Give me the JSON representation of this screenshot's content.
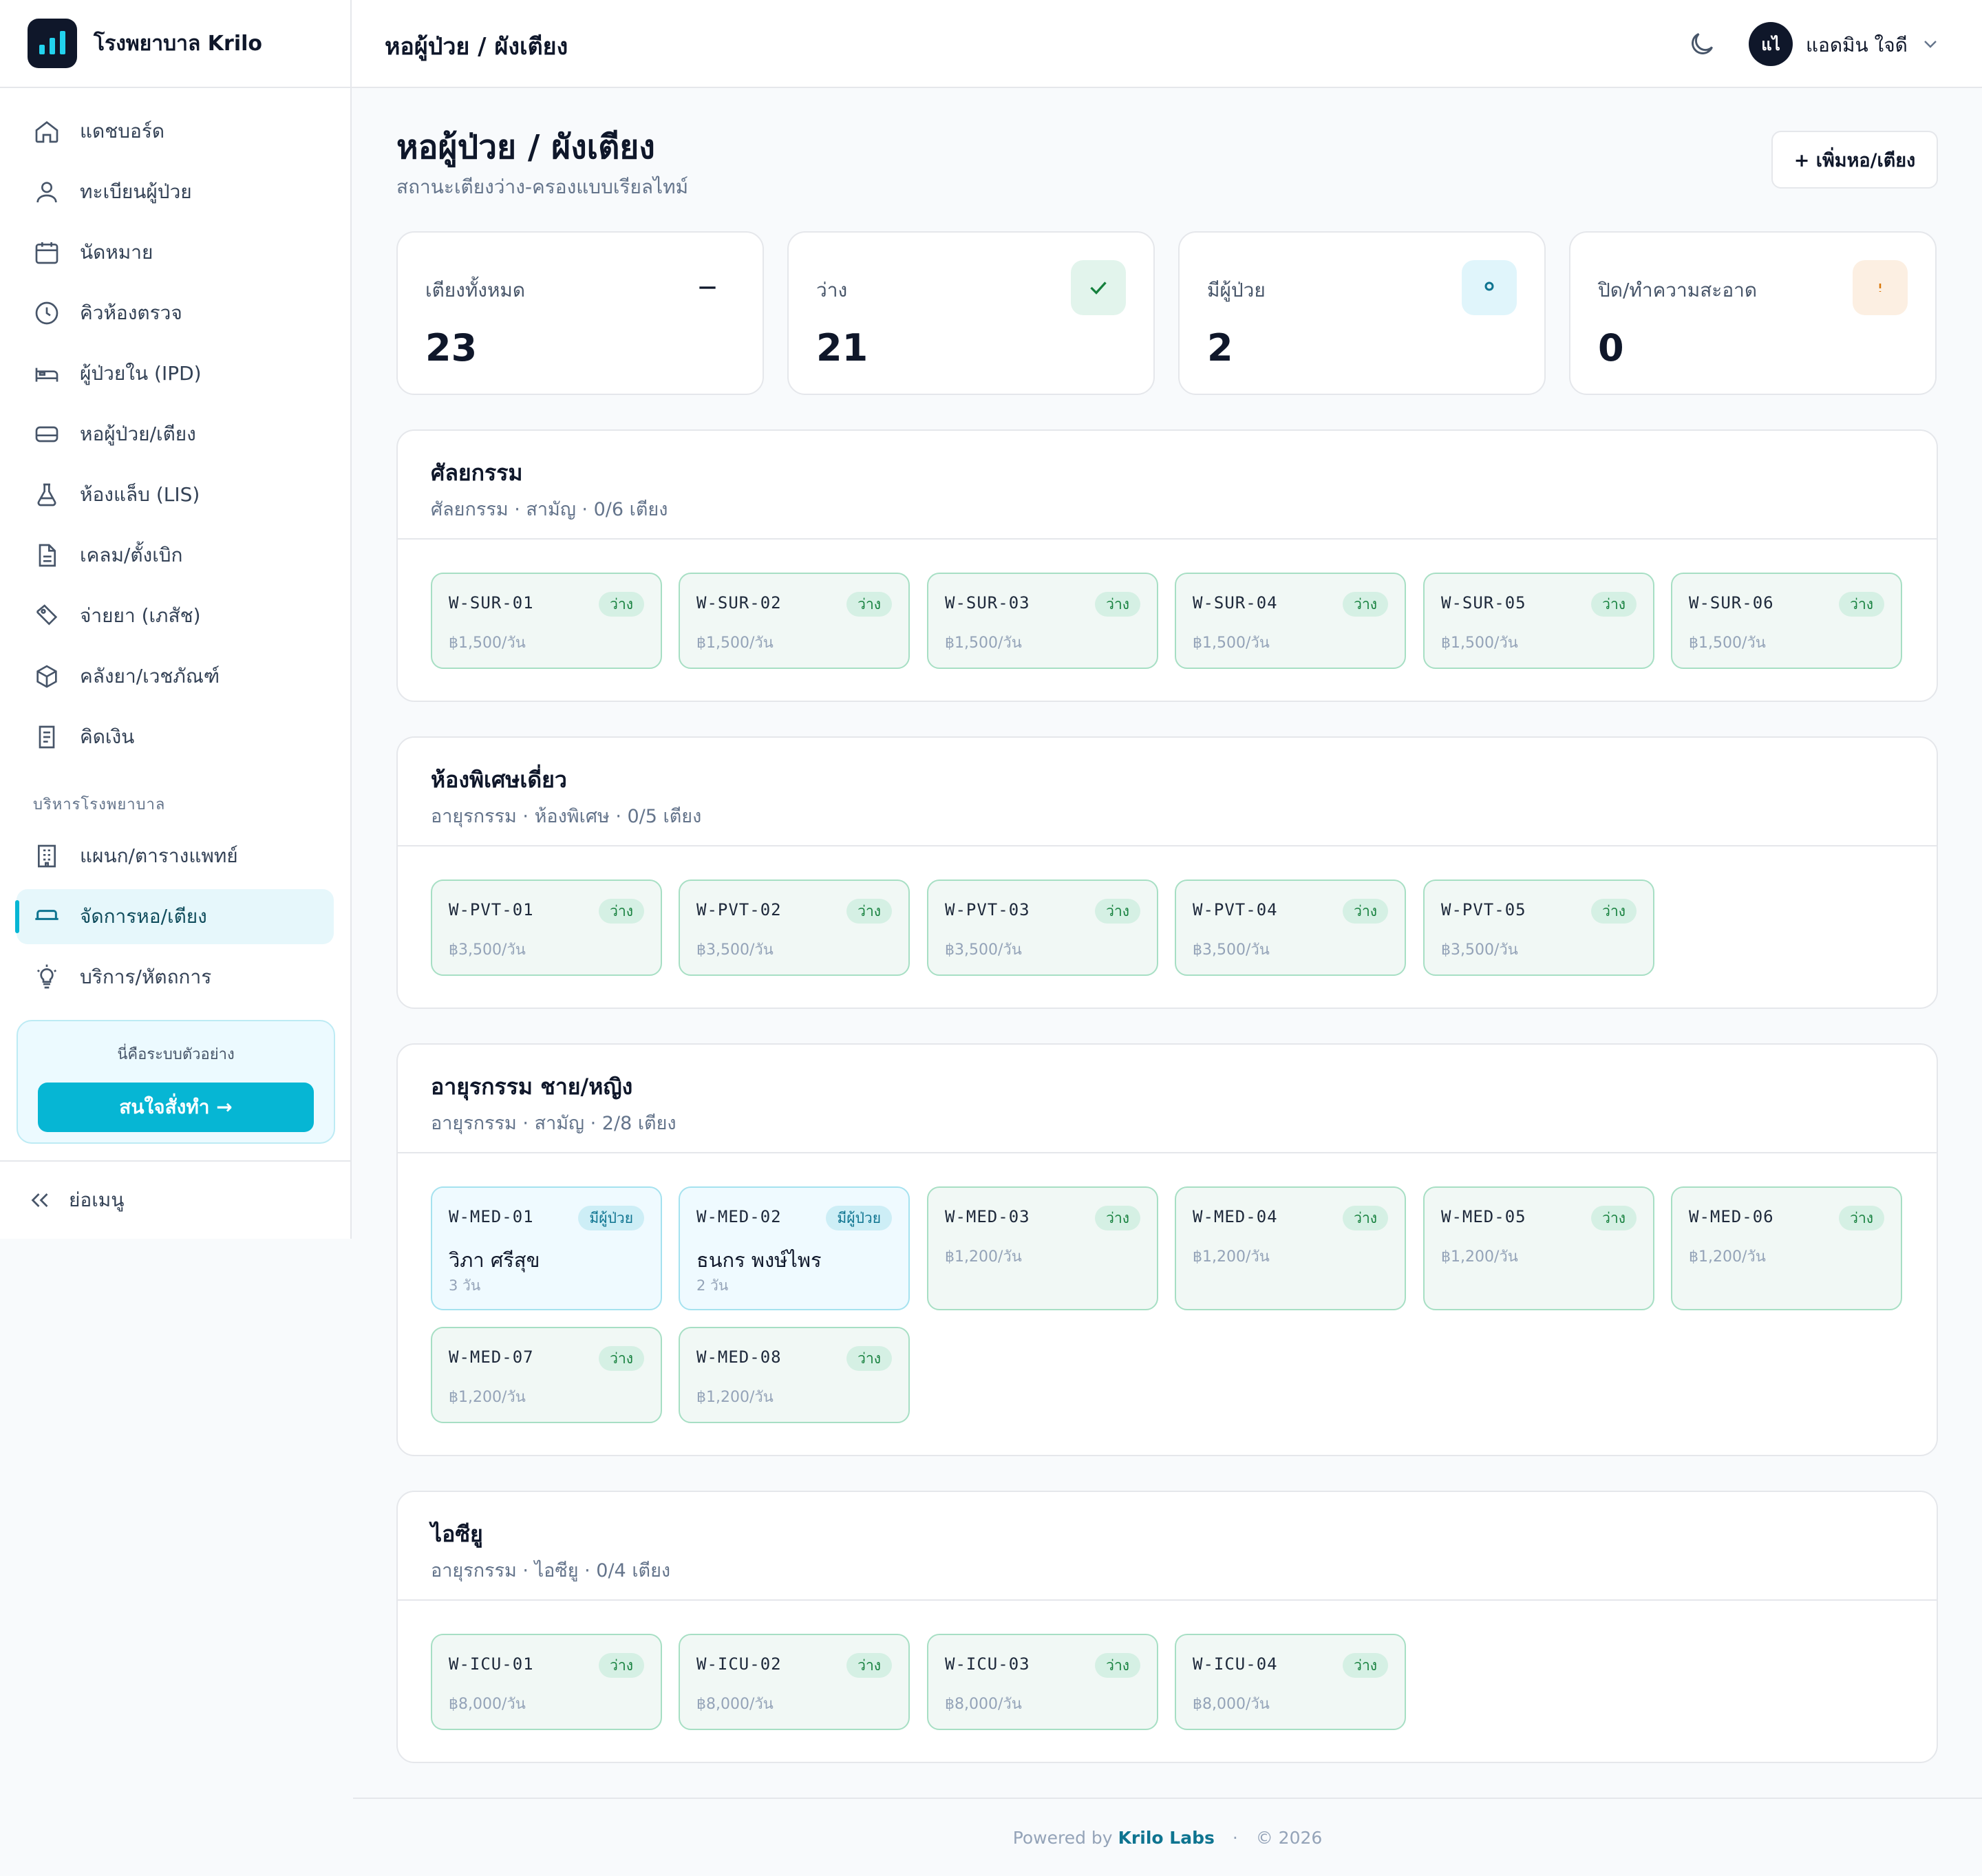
{
  "brand": {
    "name": "โรงพยาบาล Krilo",
    "logo_icon": "bar-chart-icon"
  },
  "sidebar": {
    "items": [
      {
        "label": "แดชบอร์ด",
        "icon": "home-icon"
      },
      {
        "label": "ทะเบียนผู้ป่วย",
        "icon": "user-icon"
      },
      {
        "label": "นัดหมาย",
        "icon": "calendar-icon"
      },
      {
        "label": "คิวห้องตรวจ",
        "icon": "clock-icon"
      },
      {
        "label": "ผู้ป่วยใน (IPD)",
        "icon": "bed-icon"
      },
      {
        "label": "หอผู้ป่วย/เตียง",
        "icon": "bed-outline-icon"
      },
      {
        "label": "ห้องแล็บ (LIS)",
        "icon": "flask-icon"
      },
      {
        "label": "เคลม/ตั้งเบิก",
        "icon": "document-icon"
      },
      {
        "label": "จ่ายยา (เภสัช)",
        "icon": "pill-icon"
      },
      {
        "label": "คลังยา/เวชภัณฑ์",
        "icon": "box-icon"
      },
      {
        "label": "คิดเงิน",
        "icon": "receipt-icon"
      }
    ],
    "admin_section": "บริหารโรงพยาบาล",
    "admin_items": [
      {
        "label": "แผนก/ตารางแพทย์",
        "icon": "building-icon"
      },
      {
        "label": "จัดการหอ/เตียง",
        "icon": "bed-manage-icon",
        "active": true
      },
      {
        "label": "บริการ/หัตถการ",
        "icon": "lightbulb-icon"
      }
    ],
    "promo": {
      "text": "นี่คือระบบตัวอย่าง",
      "button": "สนใจสั่งทำ →"
    },
    "collapse": "ย่อเมนู"
  },
  "topbar": {
    "title": "หอผู้ป่วย / ผังเตียง",
    "user_initials": "แไ",
    "user_name": "แอดมิน ใจดี"
  },
  "page": {
    "title": "หอผู้ป่วย / ผังเตียง",
    "subtitle": "สถานะเตียงว่าง-ครองแบบเรียลไทม์",
    "add_button": "+ เพิ่มหอ/เตียง"
  },
  "stats": [
    {
      "label": "เตียงทั้งหมด",
      "value": "23",
      "icon": "dash-icon"
    },
    {
      "label": "ว่าง",
      "value": "21",
      "icon": "check-icon"
    },
    {
      "label": "มีผู้ป่วย",
      "value": "2",
      "icon": "circle-icon"
    },
    {
      "label": "ปิด/ทำความสะอาด",
      "value": "0",
      "icon": "alert-icon"
    }
  ],
  "wards": [
    {
      "name": "ศัลยกรรม",
      "meta": "ศัลยกรรม · สามัญ · 0/6 เตียง",
      "beds": [
        {
          "code": "W-SUR-01",
          "status": "ว่าง",
          "price": "฿1,500/วัน"
        },
        {
          "code": "W-SUR-02",
          "status": "ว่าง",
          "price": "฿1,500/วัน"
        },
        {
          "code": "W-SUR-03",
          "status": "ว่าง",
          "price": "฿1,500/วัน"
        },
        {
          "code": "W-SUR-04",
          "status": "ว่าง",
          "price": "฿1,500/วัน"
        },
        {
          "code": "W-SUR-05",
          "status": "ว่าง",
          "price": "฿1,500/วัน"
        },
        {
          "code": "W-SUR-06",
          "status": "ว่าง",
          "price": "฿1,500/วัน"
        }
      ]
    },
    {
      "name": "ห้องพิเศษเดี่ยว",
      "meta": "อายุรกรรม · ห้องพิเศษ · 0/5 เตียง",
      "beds": [
        {
          "code": "W-PVT-01",
          "status": "ว่าง",
          "price": "฿3,500/วัน"
        },
        {
          "code": "W-PVT-02",
          "status": "ว่าง",
          "price": "฿3,500/วัน"
        },
        {
          "code": "W-PVT-03",
          "status": "ว่าง",
          "price": "฿3,500/วัน"
        },
        {
          "code": "W-PVT-04",
          "status": "ว่าง",
          "price": "฿3,500/วัน"
        },
        {
          "code": "W-PVT-05",
          "status": "ว่าง",
          "price": "฿3,500/วัน"
        }
      ]
    },
    {
      "name": "อายุรกรรม ชาย/หญิง",
      "meta": "อายุรกรรม · สามัญ · 2/8 เตียง",
      "beds": [
        {
          "code": "W-MED-01",
          "status": "มีผู้ป่วย",
          "patient": "วิภา ศรีสุข",
          "days": "3 วัน"
        },
        {
          "code": "W-MED-02",
          "status": "มีผู้ป่วย",
          "patient": "ธนกร พงษ์ไพร",
          "days": "2 วัน"
        },
        {
          "code": "W-MED-03",
          "status": "ว่าง",
          "price": "฿1,200/วัน"
        },
        {
          "code": "W-MED-04",
          "status": "ว่าง",
          "price": "฿1,200/วัน"
        },
        {
          "code": "W-MED-05",
          "status": "ว่าง",
          "price": "฿1,200/วัน"
        },
        {
          "code": "W-MED-06",
          "status": "ว่าง",
          "price": "฿1,200/วัน"
        },
        {
          "code": "W-MED-07",
          "status": "ว่าง",
          "price": "฿1,200/วัน"
        },
        {
          "code": "W-MED-08",
          "status": "ว่าง",
          "price": "฿1,200/วัน"
        }
      ]
    },
    {
      "name": "ไอซียู",
      "meta": "อายุรกรรม · ไอซียู · 0/4 เตียง",
      "beds": [
        {
          "code": "W-ICU-01",
          "status": "ว่าง",
          "price": "฿8,000/วัน"
        },
        {
          "code": "W-ICU-02",
          "status": "ว่าง",
          "price": "฿8,000/วัน"
        },
        {
          "code": "W-ICU-03",
          "status": "ว่าง",
          "price": "฿8,000/วัน"
        },
        {
          "code": "W-ICU-04",
          "status": "ว่าง",
          "price": "฿8,000/วัน"
        }
      ]
    }
  ],
  "footer": {
    "prefix": "Powered by",
    "brand": "Krilo Labs",
    "copyright": "© 2026"
  },
  "colors": {
    "accent": "#06b6d4",
    "free": "#15803d",
    "occupied": "#0e7490",
    "dark": "#0f172a"
  }
}
